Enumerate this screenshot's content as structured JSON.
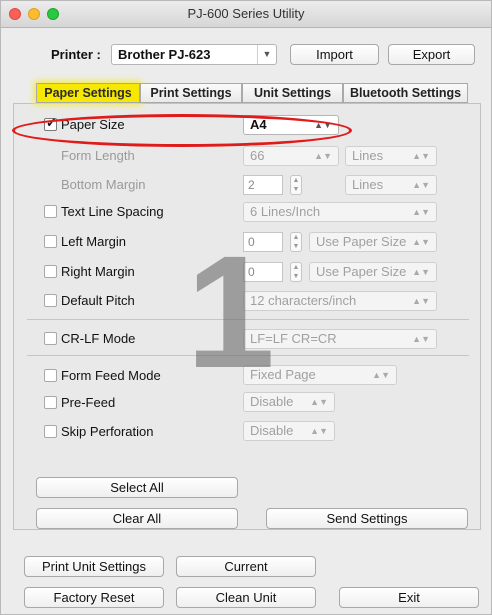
{
  "window": {
    "title": "PJ-600 Series Utility"
  },
  "printer": {
    "label": "Printer :",
    "value": "Brother PJ-623",
    "import_label": "Import",
    "export_label": "Export"
  },
  "tabs": [
    {
      "label": "Paper Settings",
      "active": true
    },
    {
      "label": "Print Settings",
      "active": false
    },
    {
      "label": "Unit Settings",
      "active": false
    },
    {
      "label": "Bluetooth Settings",
      "active": false
    }
  ],
  "paper_settings": {
    "paper_size": {
      "label": "Paper Size",
      "checked": true,
      "value": "A4"
    },
    "form_length": {
      "label": "Form Length",
      "value": "66",
      "unit": "Lines"
    },
    "bottom_margin": {
      "label": "Bottom Margin",
      "value": "2",
      "unit": "Lines"
    },
    "text_line_spacing": {
      "label": "Text Line Spacing",
      "checked": false,
      "value": "6 Lines/Inch"
    },
    "left_margin": {
      "label": "Left Margin",
      "checked": false,
      "value": "0",
      "unit": "Use Paper Size"
    },
    "right_margin": {
      "label": "Right Margin",
      "checked": false,
      "value": "0",
      "unit": "Use Paper Size"
    },
    "default_pitch": {
      "label": "Default Pitch",
      "checked": false,
      "value": "12 characters/inch"
    },
    "crlf_mode": {
      "label": "CR-LF Mode",
      "checked": false,
      "value": "LF=LF CR=CR"
    },
    "form_feed_mode": {
      "label": "Form Feed Mode",
      "checked": false,
      "value": "Fixed Page"
    },
    "pre_feed": {
      "label": "Pre-Feed",
      "checked": false,
      "value": "Disable"
    },
    "skip_perforation": {
      "label": "Skip Perforation",
      "checked": false,
      "value": "Disable"
    }
  },
  "panel_buttons": {
    "select_all": "Select All",
    "clear_all": "Clear All",
    "send_settings": "Send Settings"
  },
  "bottom_buttons": {
    "print_unit_settings": "Print Unit Settings",
    "current": "Current",
    "factory_reset": "Factory Reset",
    "clean_unit": "Clean Unit",
    "exit": "Exit"
  },
  "annotation": {
    "number": "1",
    "ring_color": "#e01b1b"
  },
  "colors": {
    "active_tab_highlight": "#f6e800"
  }
}
